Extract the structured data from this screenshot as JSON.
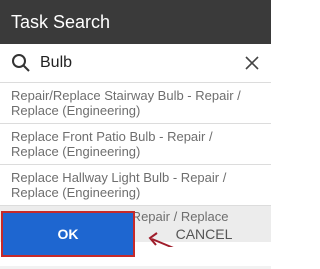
{
  "dialog": {
    "title": "Task Search"
  },
  "search": {
    "value": "Bulb",
    "search_icon": "search-icon",
    "clear_icon": "close-icon"
  },
  "results": [
    {
      "label": "Repair/Replace Stairway Bulb - Repair / Replace (Engineering)"
    },
    {
      "label": "Replace Front Patio Bulb - Repair / Replace (Engineering)"
    },
    {
      "label": "Replace Hallway Light Bulb - Repair / Replace (Engineering)"
    },
    {
      "label": "Replace Light Bulb - Repair / Replace (Engineering)",
      "highlighted": true
    }
  ],
  "annotation": {
    "icon": "arrow-annotation",
    "color": "#a01d2b"
  },
  "buttons": {
    "ok_label": "OK",
    "cancel_label": "CANCEL"
  },
  "colors": {
    "header_bg": "#3a3a3a",
    "ok_bg": "#1e66d0",
    "ok_border": "#c62a2a",
    "highlight_bg": "#ececec"
  }
}
